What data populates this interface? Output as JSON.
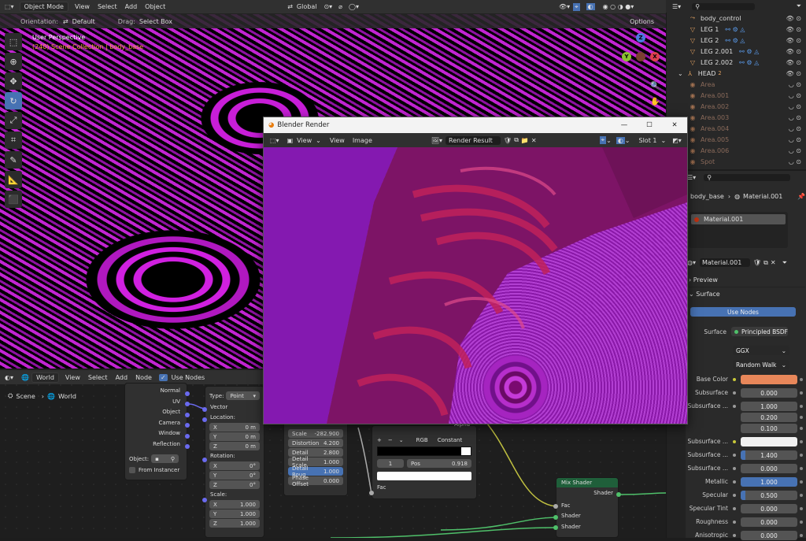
{
  "viewport": {
    "mode": "Object Mode",
    "menus": [
      "View",
      "Select",
      "Add",
      "Object"
    ],
    "orientation_label": "Orientation:",
    "orientation_value": "Default",
    "drag_label": "Drag:",
    "drag_value": "Select Box",
    "transform": "Global",
    "options": "Options",
    "perspective": "User Perspective",
    "collection": "(240) Scene Collection | body_base",
    "gizmo": {
      "z": "Z",
      "y": "Y",
      "x": "X"
    }
  },
  "outliner": {
    "items": [
      {
        "name": "body_control",
        "icon": "empty-icon",
        "indent": 1
      },
      {
        "name": "LEG 1",
        "icon": "mesh-icon",
        "indent": 1
      },
      {
        "name": "LEG 2",
        "icon": "mesh-icon",
        "indent": 1
      },
      {
        "name": "LEG 2.001",
        "icon": "mesh-icon",
        "indent": 1
      },
      {
        "name": "LEG 2.002",
        "icon": "mesh-icon",
        "indent": 1
      },
      {
        "name": "HEAD",
        "icon": "armature-icon",
        "indent": 0,
        "badge": "2"
      },
      {
        "name": "Area",
        "icon": "light-icon",
        "indent": 1
      },
      {
        "name": "Area.001",
        "icon": "light-icon",
        "indent": 1
      },
      {
        "name": "Area.002",
        "icon": "light-icon",
        "indent": 1
      },
      {
        "name": "Area.003",
        "icon": "light-icon",
        "indent": 1
      },
      {
        "name": "Area.004",
        "icon": "light-icon",
        "indent": 1
      },
      {
        "name": "Area.005",
        "icon": "light-icon",
        "indent": 1
      },
      {
        "name": "Area.006",
        "icon": "light-icon",
        "indent": 1
      },
      {
        "name": "Spot",
        "icon": "light-icon",
        "indent": 1
      }
    ]
  },
  "properties": {
    "crumb_object": "body_base",
    "crumb_material": "Material.001",
    "slot": "Material.001",
    "material": "Material.001",
    "preview": "Preview",
    "surface_panel": "Surface",
    "use_nodes": "Use Nodes",
    "surface_label": "Surface",
    "surface_value": "Principled BSDF",
    "distribution": "GGX",
    "subsurface_method": "Random Walk",
    "rows": [
      {
        "label": "Base Color",
        "value": "",
        "type": "color",
        "color": "#e8875a"
      },
      {
        "label": "Subsurface",
        "value": "0.000"
      },
      {
        "label": "Subsurface ...",
        "value": "1.000"
      },
      {
        "label": "",
        "value": "0.200"
      },
      {
        "label": "",
        "value": "0.100"
      },
      {
        "label": "Subsurface ...",
        "value": "",
        "type": "color",
        "color": "#f0f0f0"
      },
      {
        "label": "Subsurface ...",
        "value": "1.400",
        "fill": 0.08
      },
      {
        "label": "Subsurface ...",
        "value": "0.000"
      },
      {
        "label": "Metallic",
        "value": "1.000",
        "fill": 1.0
      },
      {
        "label": "Specular",
        "value": "0.500",
        "fill": 0.08
      },
      {
        "label": "Specular Tint",
        "value": "0.000"
      },
      {
        "label": "Roughness",
        "value": "0.000"
      },
      {
        "label": "Anisotropic",
        "value": "0.000"
      }
    ]
  },
  "node_editor": {
    "world": "World",
    "menus": [
      "View",
      "Select",
      "Add",
      "Node"
    ],
    "use_nodes": "Use Nodes",
    "crumb_scene": "Scene",
    "crumb_world": "World",
    "texcoord": {
      "outputs": [
        "Normal",
        "UV",
        "Object",
        "Camera",
        "Window",
        "Reflection"
      ],
      "object_label": "Object:",
      "instancer": "From Instancer"
    },
    "mapping": {
      "type_label": "Type:",
      "type_value": "Point",
      "vector": "Vector",
      "location": "Location:",
      "rotation": "Rotation:",
      "scale": "Scale:",
      "loc": [
        [
          "X",
          "0 m"
        ],
        [
          "Y",
          "0 m"
        ],
        [
          "Z",
          "0 m"
        ]
      ],
      "rot": [
        [
          "X",
          "0°"
        ],
        [
          "Y",
          "0°"
        ],
        [
          "Z",
          "0°"
        ]
      ],
      "scl": [
        [
          "X",
          "1.000"
        ],
        [
          "Y",
          "1.000"
        ],
        [
          "Z",
          "1.000"
        ]
      ]
    },
    "noise": {
      "fields": [
        [
          "Scale",
          "-282.900"
        ],
        [
          "Distortion",
          "4.200"
        ],
        [
          "Detail",
          "2.800"
        ],
        [
          "Detail Scale",
          "1.000"
        ],
        [
          "Detail Roug",
          "1.000"
        ],
        [
          "Phase Offset",
          "0.000"
        ]
      ],
      "header": "Vector"
    },
    "ramp": {
      "alpha": "Alpha",
      "mode": "RGB",
      "interp": "Constant",
      "stop_index": "1",
      "pos_label": "Pos",
      "pos_value": "0.918",
      "fac": "Fac"
    },
    "mix": {
      "title": "Mix Shader",
      "shader_out": "Shader",
      "fac": "Fac",
      "shader1": "Shader",
      "shader2": "Shader"
    }
  },
  "render_window": {
    "title": "Blender Render",
    "menus": [
      "View",
      "Image"
    ],
    "result": "Render Result",
    "slot": "Slot 1"
  }
}
